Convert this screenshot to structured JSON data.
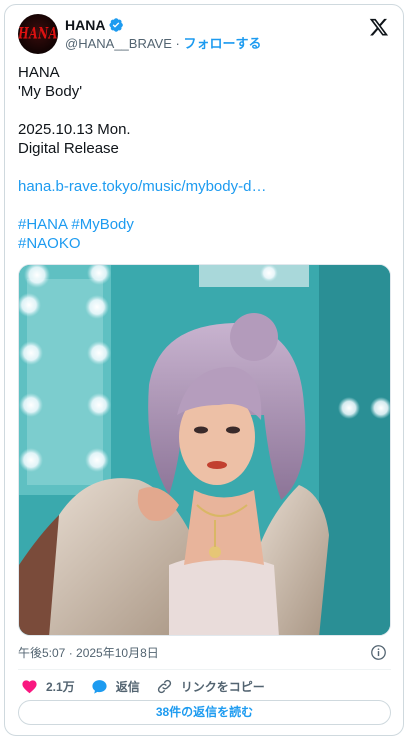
{
  "author": {
    "display_name": "HANA",
    "handle": "@HANA__BRAVE",
    "separator": " · ",
    "follow_label": "フォローする",
    "avatar_text": "HANA",
    "verified": true
  },
  "tweet": {
    "lines": [
      "HANA",
      "'My Body'",
      "",
      "2025.10.13 Mon.",
      "Digital Release",
      "",
      "hana.b-rave.tokyo/music/mybody-d…",
      "",
      "#HANA #MyBody",
      "#NAOKO"
    ],
    "timestamp": "午後5:07 · 2025年10月8日"
  },
  "photo": {
    "description_colors": {
      "wall": "#2f9ea3",
      "hair": "#a88fb0",
      "skin": "#e9b9a0",
      "fur": "#c9b9a6",
      "top": "#e6d9d6"
    }
  },
  "actions": {
    "like_count": "2.1万",
    "reply_label": "返信",
    "copy_link_label": "リンクをコピー"
  },
  "footer": {
    "read_replies_label": "38件の返信を読む"
  },
  "colors": {
    "accent": "#1d9bf0",
    "like": "#f91880",
    "muted": "#536471"
  }
}
